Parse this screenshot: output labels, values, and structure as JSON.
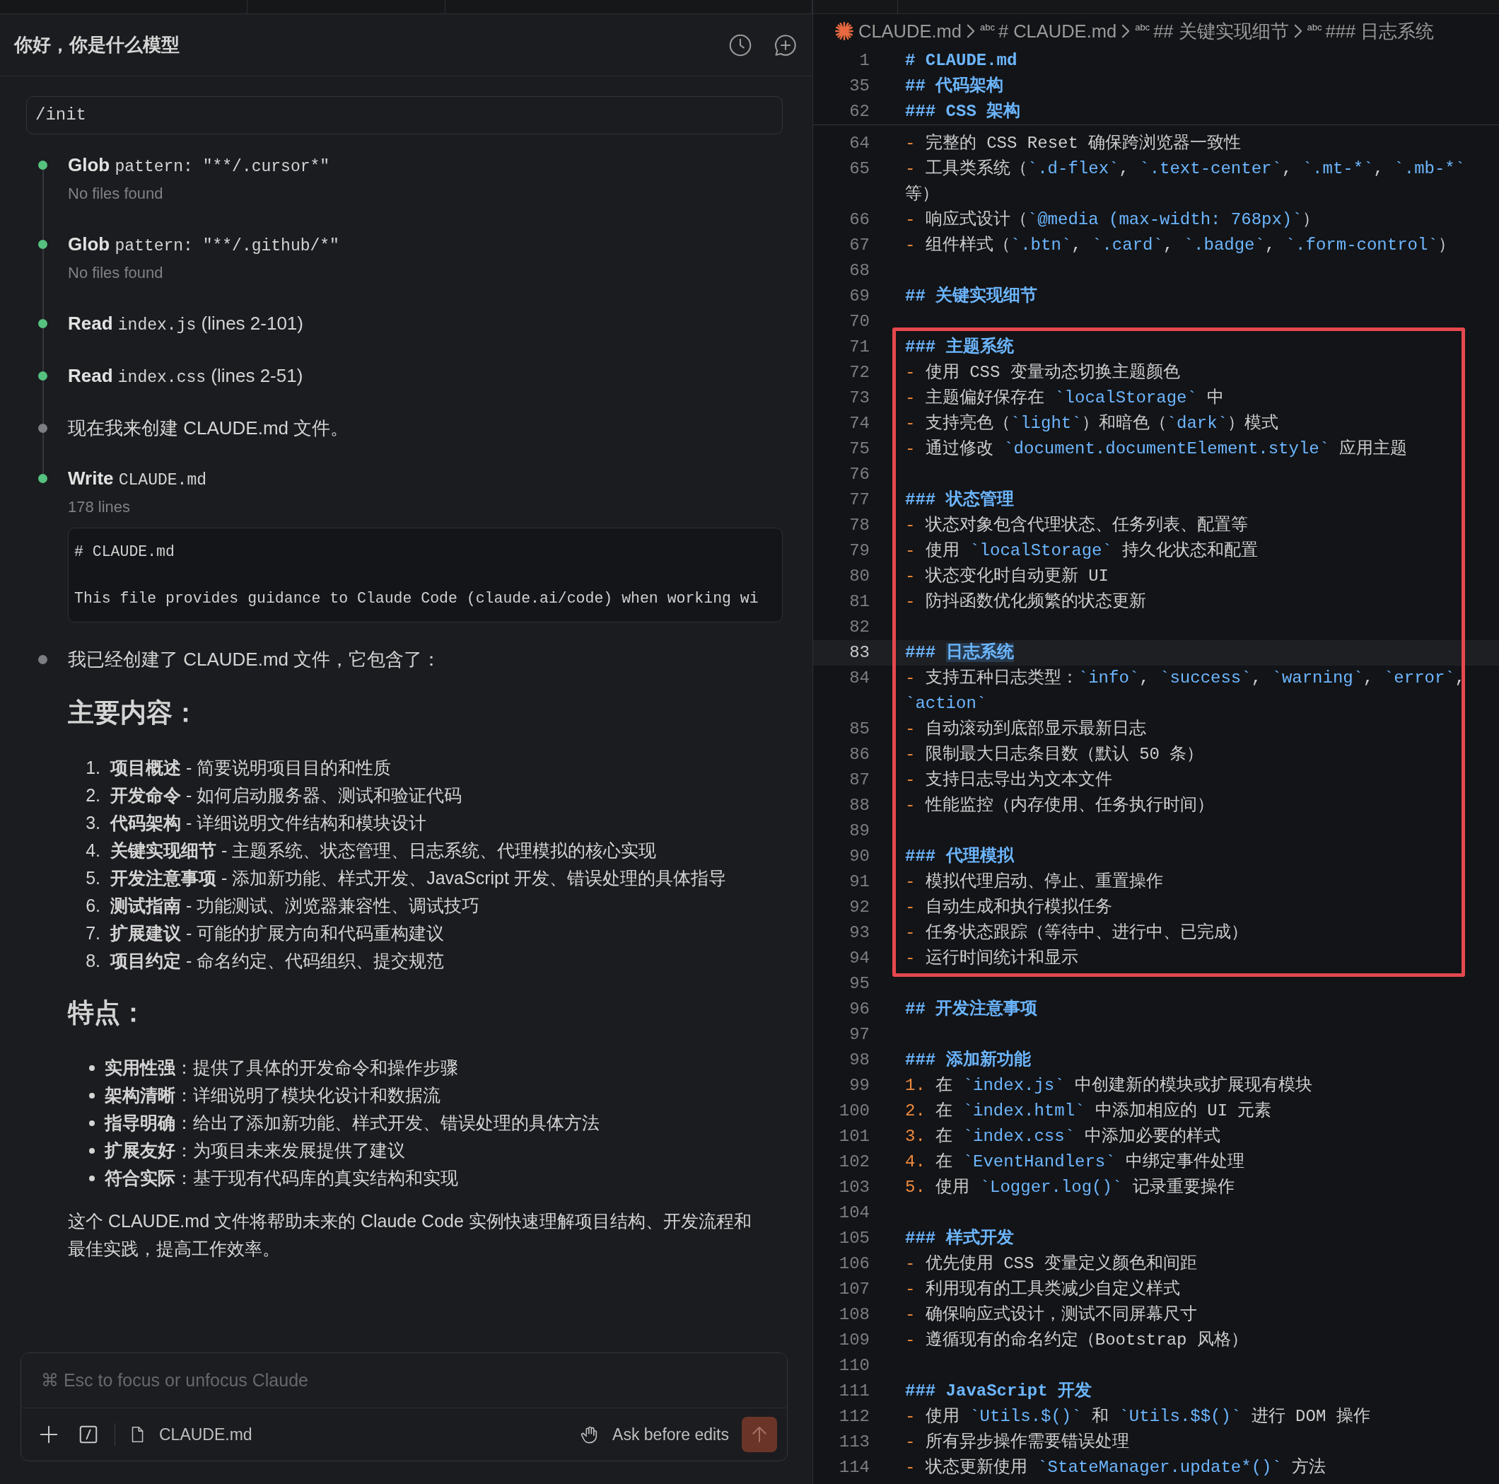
{
  "chat": {
    "title": "你好，你是什么模型",
    "prompt": "/init",
    "steps": [
      {
        "kind": "tool",
        "color": "#55c27f",
        "name": "Glob",
        "args": "pattern: \"**/.cursor*\"",
        "result": "No files found"
      },
      {
        "kind": "tool",
        "color": "#55c27f",
        "name": "Glob",
        "args": "pattern: \"**/.github/*\"",
        "result": "No files found"
      },
      {
        "kind": "tool",
        "color": "#55c27f",
        "name": "Read",
        "file": "index.js",
        "detail": "(lines 2-101)"
      },
      {
        "kind": "tool",
        "color": "#55c27f",
        "name": "Read",
        "file": "index.css",
        "detail": "(lines 2-51)"
      },
      {
        "kind": "message",
        "color": "#7c7e83",
        "text": "现在我来创建 CLAUDE.md 文件。"
      },
      {
        "kind": "tool",
        "color": "#55c27f",
        "name": "Write",
        "file": "CLAUDE.md",
        "result": "178 lines",
        "preview": [
          "# CLAUDE.md",
          "This file provides guidance to Claude Code (claude.ai/code) when working wi"
        ]
      },
      {
        "kind": "message",
        "color": "#7c7e83",
        "text": "我已经创建了 CLAUDE.md 文件，它包含了："
      }
    ],
    "response": [
      {
        "kind": "heading",
        "text": "主要内容："
      },
      {
        "kind": "ordered",
        "items": [
          {
            "number": "1.",
            "text": "**项目概述** - 简要说明项目目的和性质"
          },
          {
            "number": "2.",
            "text": "**开发命令** - 如何启动服务器、测试和验证代码"
          },
          {
            "number": "3.",
            "text": "**代码架构** - 详细说明文件结构和模块设计"
          },
          {
            "number": "4.",
            "text": "**关键实现细节** - 主题系统、状态管理、日志系统、代理模拟的核心实现"
          },
          {
            "number": "5.",
            "text": "**开发注意事项** - 添加新功能、样式开发、JavaScript 开发、错误处理的具体指导"
          },
          {
            "number": "6.",
            "text": "**测试指南** - 功能测试、浏览器兼容性、调试技巧"
          },
          {
            "number": "7.",
            "text": "**扩展建议** - 可能的扩展方向和代码重构建议"
          },
          {
            "number": "8.",
            "text": "**项目约定** - 命名约定、代码组织、提交规范"
          }
        ]
      },
      {
        "kind": "heading",
        "text": "特点："
      },
      {
        "kind": "bullets",
        "items": [
          "**实用性强**：提供了具体的开发命令和操作步骤",
          "**架构清晰**：详细说明了模块化设计和数据流",
          "**指导明确**：给出了添加新功能、样式开发、错误处理的具体方法",
          "**扩展友好**：为项目未来发展提供了建议",
          "**符合实际**：基于现有代码库的真实结构和实现"
        ]
      },
      {
        "kind": "paragraph",
        "text": "这个 CLAUDE.md 文件将帮助未来的 Claude Code 实例快速理解项目结构、开发流程和最佳实践，提高工作效率。"
      }
    ],
    "composer": {
      "placeholder": "⌘ Esc to focus or unfocus Claude",
      "attachment": "CLAUDE.md",
      "mode": "Ask before edits",
      "send_disabled": true
    }
  },
  "editor": {
    "breadcrumb": [
      {
        "kind": "file",
        "label": "CLAUDE.md"
      },
      {
        "kind": "symbol",
        "symbol": "abc",
        "label": "# CLAUDE.md"
      },
      {
        "kind": "symbol",
        "symbol": "abc",
        "label": "## 关键实现细节"
      },
      {
        "kind": "symbol",
        "symbol": "abc",
        "label": "### 日志系统"
      }
    ],
    "sticky": [
      {
        "number": "1",
        "spans": [
          {
            "kind": "heading",
            "text": "# CLAUDE.md"
          }
        ]
      },
      {
        "number": "35",
        "spans": [
          {
            "kind": "heading",
            "text": "## 代码架构"
          }
        ]
      },
      {
        "number": "62",
        "spans": [
          {
            "kind": "heading",
            "text": "### CSS 架构"
          }
        ]
      }
    ],
    "groups": [
      {
        "boxed": false,
        "lines": [
          {
            "number": "64",
            "current": false,
            "spans": [
              {
                "kind": "marker",
                "text": "- "
              },
              {
                "kind": "text",
                "text": "完整的 CSS Reset 确保跨浏览器一致性"
              }
            ]
          },
          {
            "number": "65",
            "current": false,
            "spans": [
              {
                "kind": "marker",
                "text": "- "
              },
              {
                "kind": "text",
                "text": "工具类系统（"
              },
              {
                "kind": "code",
                "text": "`.d-flex`"
              },
              {
                "kind": "text",
                "text": ", "
              },
              {
                "kind": "code",
                "text": "`.text-center`"
              },
              {
                "kind": "text",
                "text": ", "
              },
              {
                "kind": "code",
                "text": "`.mt-*`"
              },
              {
                "kind": "text",
                "text": ", "
              },
              {
                "kind": "code",
                "text": "`.mb-*`"
              }
            ]
          },
          {
            "current": false,
            "spans": [
              {
                "kind": "text",
                "text": "等）"
              }
            ]
          },
          {
            "number": "66",
            "current": false,
            "spans": [
              {
                "kind": "marker",
                "text": "- "
              },
              {
                "kind": "text",
                "text": "响应式设计（"
              },
              {
                "kind": "code",
                "text": "`@media (max-width: 768px)`"
              },
              {
                "kind": "text",
                "text": "）"
              }
            ]
          },
          {
            "number": "67",
            "current": false,
            "spans": [
              {
                "kind": "marker",
                "text": "- "
              },
              {
                "kind": "text",
                "text": "组件样式（"
              },
              {
                "kind": "code",
                "text": "`.btn`"
              },
              {
                "kind": "text",
                "text": ", "
              },
              {
                "kind": "code",
                "text": "`.card`"
              },
              {
                "kind": "text",
                "text": ", "
              },
              {
                "kind": "code",
                "text": "`.badge`"
              },
              {
                "kind": "text",
                "text": ", "
              },
              {
                "kind": "code",
                "text": "`.form-control`"
              },
              {
                "kind": "text",
                "text": "）"
              }
            ]
          },
          {
            "number": "68",
            "current": false
          },
          {
            "number": "69",
            "current": false,
            "spans": [
              {
                "kind": "heading",
                "text": "## 关键实现细节"
              }
            ]
          },
          {
            "number": "70",
            "current": false
          }
        ]
      },
      {
        "boxed": true,
        "lines": [
          {
            "number": "71",
            "current": false,
            "spans": [
              {
                "kind": "heading",
                "text": "### 主题系统"
              }
            ]
          },
          {
            "number": "72",
            "current": false,
            "spans": [
              {
                "kind": "marker",
                "text": "- "
              },
              {
                "kind": "text",
                "text": "使用 CSS 变量动态切换主题颜色"
              }
            ]
          },
          {
            "number": "73",
            "current": false,
            "spans": [
              {
                "kind": "marker",
                "text": "- "
              },
              {
                "kind": "text",
                "text": "主题偏好保存在 "
              },
              {
                "kind": "code",
                "text": "`localStorage`"
              },
              {
                "kind": "text",
                "text": " 中"
              }
            ]
          },
          {
            "number": "74",
            "current": false,
            "spans": [
              {
                "kind": "marker",
                "text": "- "
              },
              {
                "kind": "text",
                "text": "支持亮色（"
              },
              {
                "kind": "code",
                "text": "`light`"
              },
              {
                "kind": "text",
                "text": "）和暗色（"
              },
              {
                "kind": "code",
                "text": "`dark`"
              },
              {
                "kind": "text",
                "text": "）模式"
              }
            ]
          },
          {
            "number": "75",
            "current": false,
            "spans": [
              {
                "kind": "marker",
                "text": "- "
              },
              {
                "kind": "text",
                "text": "通过修改 "
              },
              {
                "kind": "code",
                "text": "`document.documentElement.style`"
              },
              {
                "kind": "text",
                "text": " 应用主题"
              }
            ]
          },
          {
            "number": "76",
            "current": false
          },
          {
            "number": "77",
            "current": false,
            "spans": [
              {
                "kind": "heading",
                "text": "### 状态管理"
              }
            ]
          },
          {
            "number": "78",
            "current": false,
            "spans": [
              {
                "kind": "marker",
                "text": "- "
              },
              {
                "kind": "text",
                "text": "状态对象包含代理状态、任务列表、配置等"
              }
            ]
          },
          {
            "number": "79",
            "current": false,
            "spans": [
              {
                "kind": "marker",
                "text": "- "
              },
              {
                "kind": "text",
                "text": "使用 "
              },
              {
                "kind": "code",
                "text": "`localStorage`"
              },
              {
                "kind": "text",
                "text": " 持久化状态和配置"
              }
            ]
          },
          {
            "number": "80",
            "current": false,
            "spans": [
              {
                "kind": "marker",
                "text": "- "
              },
              {
                "kind": "text",
                "text": "状态变化时自动更新 UI"
              }
            ]
          },
          {
            "number": "81",
            "current": false,
            "spans": [
              {
                "kind": "marker",
                "text": "- "
              },
              {
                "kind": "text",
                "text": "防抖函数优化频繁的状态更新"
              }
            ]
          },
          {
            "number": "82",
            "current": false
          },
          {
            "number": "83",
            "current": true,
            "spans": [
              {
                "kind": "heading",
                "text": "### "
              },
              {
                "kind": "match",
                "text": "日志系统"
              }
            ]
          },
          {
            "number": "84",
            "current": false,
            "spans": [
              {
                "kind": "marker",
                "text": "- "
              },
              {
                "kind": "text",
                "text": "支持五种日志类型："
              },
              {
                "kind": "code",
                "text": "`info`"
              },
              {
                "kind": "text",
                "text": ", "
              },
              {
                "kind": "code",
                "text": "`success`"
              },
              {
                "kind": "text",
                "text": ", "
              },
              {
                "kind": "code",
                "text": "`warning`"
              },
              {
                "kind": "text",
                "text": ", "
              },
              {
                "kind": "code",
                "text": "`error`"
              },
              {
                "kind": "text",
                "text": ","
              }
            ]
          },
          {
            "current": false,
            "spans": [
              {
                "kind": "code",
                "text": "`action`"
              }
            ]
          },
          {
            "number": "85",
            "current": false,
            "spans": [
              {
                "kind": "marker",
                "text": "- "
              },
              {
                "kind": "text",
                "text": "自动滚动到底部显示最新日志"
              }
            ]
          },
          {
            "number": "86",
            "current": false,
            "spans": [
              {
                "kind": "marker",
                "text": "- "
              },
              {
                "kind": "text",
                "text": "限制最大日志条目数（默认 50 条）"
              }
            ]
          },
          {
            "number": "87",
            "current": false,
            "spans": [
              {
                "kind": "marker",
                "text": "- "
              },
              {
                "kind": "text",
                "text": "支持日志导出为文本文件"
              }
            ]
          },
          {
            "number": "88",
            "current": false,
            "spans": [
              {
                "kind": "marker",
                "text": "- "
              },
              {
                "kind": "text",
                "text": "性能监控（内存使用、任务执行时间）"
              }
            ]
          },
          {
            "number": "89",
            "current": false
          },
          {
            "number": "90",
            "current": false,
            "spans": [
              {
                "kind": "heading",
                "text": "### 代理模拟"
              }
            ]
          },
          {
            "number": "91",
            "current": false,
            "spans": [
              {
                "kind": "marker",
                "text": "- "
              },
              {
                "kind": "text",
                "text": "模拟代理启动、停止、重置操作"
              }
            ]
          },
          {
            "number": "92",
            "current": false,
            "spans": [
              {
                "kind": "marker",
                "text": "- "
              },
              {
                "kind": "text",
                "text": "自动生成和执行模拟任务"
              }
            ]
          },
          {
            "number": "93",
            "current": false,
            "spans": [
              {
                "kind": "marker",
                "text": "- "
              },
              {
                "kind": "text",
                "text": "任务状态跟踪（等待中、进行中、已完成）"
              }
            ]
          },
          {
            "number": "94",
            "current": false,
            "spans": [
              {
                "kind": "marker",
                "text": "- "
              },
              {
                "kind": "text",
                "text": "运行时间统计和显示"
              }
            ]
          }
        ]
      },
      {
        "boxed": false,
        "lines": [
          {
            "number": "95",
            "current": false
          },
          {
            "number": "96",
            "current": false,
            "spans": [
              {
                "kind": "heading",
                "text": "## 开发注意事项"
              }
            ]
          },
          {
            "number": "97",
            "current": false
          },
          {
            "number": "98",
            "current": false,
            "spans": [
              {
                "kind": "heading",
                "text": "### 添加新功能"
              }
            ]
          },
          {
            "number": "99",
            "current": false,
            "spans": [
              {
                "kind": "marker",
                "text": "1. "
              },
              {
                "kind": "text",
                "text": "在 "
              },
              {
                "kind": "code",
                "text": "`index.js`"
              },
              {
                "kind": "text",
                "text": " 中创建新的模块或扩展现有模块"
              }
            ]
          },
          {
            "number": "100",
            "current": false,
            "spans": [
              {
                "kind": "marker",
                "text": "2. "
              },
              {
                "kind": "text",
                "text": "在 "
              },
              {
                "kind": "code",
                "text": "`index.html`"
              },
              {
                "kind": "text",
                "text": " 中添加相应的 UI 元素"
              }
            ]
          },
          {
            "number": "101",
            "current": false,
            "spans": [
              {
                "kind": "marker",
                "text": "3. "
              },
              {
                "kind": "text",
                "text": "在 "
              },
              {
                "kind": "code",
                "text": "`index.css`"
              },
              {
                "kind": "text",
                "text": " 中添加必要的样式"
              }
            ]
          },
          {
            "number": "102",
            "current": false,
            "spans": [
              {
                "kind": "marker",
                "text": "4. "
              },
              {
                "kind": "text",
                "text": "在 "
              },
              {
                "kind": "code",
                "text": "`EventHandlers`"
              },
              {
                "kind": "text",
                "text": " 中绑定事件处理"
              }
            ]
          },
          {
            "number": "103",
            "current": false,
            "spans": [
              {
                "kind": "marker",
                "text": "5. "
              },
              {
                "kind": "text",
                "text": "使用 "
              },
              {
                "kind": "code",
                "text": "`Logger.log()`"
              },
              {
                "kind": "text",
                "text": " 记录重要操作"
              }
            ]
          },
          {
            "number": "104",
            "current": false
          },
          {
            "number": "105",
            "current": false,
            "spans": [
              {
                "kind": "heading",
                "text": "### 样式开发"
              }
            ]
          },
          {
            "number": "106",
            "current": false,
            "spans": [
              {
                "kind": "marker",
                "text": "- "
              },
              {
                "kind": "text",
                "text": "优先使用 CSS 变量定义颜色和间距"
              }
            ]
          },
          {
            "number": "107",
            "current": false,
            "spans": [
              {
                "kind": "marker",
                "text": "- "
              },
              {
                "kind": "text",
                "text": "利用现有的工具类减少自定义样式"
              }
            ]
          },
          {
            "number": "108",
            "current": false,
            "spans": [
              {
                "kind": "marker",
                "text": "- "
              },
              {
                "kind": "text",
                "text": "确保响应式设计，测试不同屏幕尺寸"
              }
            ]
          },
          {
            "number": "109",
            "current": false,
            "spans": [
              {
                "kind": "marker",
                "text": "- "
              },
              {
                "kind": "text",
                "text": "遵循现有的命名约定（Bootstrap 风格）"
              }
            ]
          },
          {
            "number": "110",
            "current": false
          },
          {
            "number": "111",
            "current": false,
            "spans": [
              {
                "kind": "heading",
                "text": "### JavaScript 开发"
              }
            ]
          },
          {
            "number": "112",
            "current": false,
            "spans": [
              {
                "kind": "marker",
                "text": "- "
              },
              {
                "kind": "text",
                "text": "使用 "
              },
              {
                "kind": "code",
                "text": "`Utils.$()`"
              },
              {
                "kind": "text",
                "text": " 和 "
              },
              {
                "kind": "code",
                "text": "`Utils.$$()`"
              },
              {
                "kind": "text",
                "text": " 进行 DOM 操作"
              }
            ]
          },
          {
            "number": "113",
            "current": false,
            "spans": [
              {
                "kind": "marker",
                "text": "- "
              },
              {
                "kind": "text",
                "text": "所有异步操作需要错误处理"
              }
            ]
          },
          {
            "number": "114",
            "current": false,
            "spans": [
              {
                "kind": "marker",
                "text": "- "
              },
              {
                "kind": "text",
                "text": "状态更新使用 "
              },
              {
                "kind": "code",
                "text": "`StateManager.update*()`"
              },
              {
                "kind": "text",
                "text": " 方法"
              }
            ]
          }
        ]
      }
    ]
  }
}
